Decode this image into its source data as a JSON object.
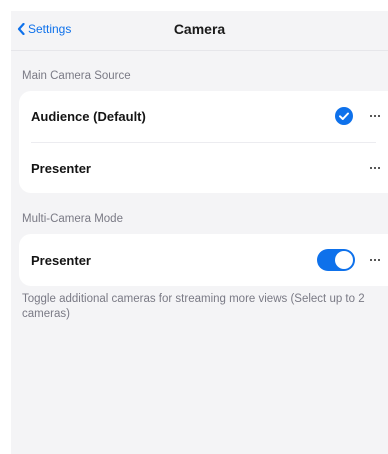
{
  "navbar": {
    "back_label": "Settings",
    "title": "Camera"
  },
  "main_camera": {
    "section_label": "Main Camera Source",
    "rows": [
      {
        "label": "Audience (Default)",
        "selected": true
      },
      {
        "label": "Presenter",
        "selected": false
      }
    ]
  },
  "multi_camera": {
    "section_label": "Multi-Camera Mode",
    "rows": [
      {
        "label": "Presenter",
        "enabled": true
      }
    ],
    "helper_text": "Toggle additional cameras for streaming more views (Select up to 2 cameras)"
  },
  "colors": {
    "accent": "#0e71eb",
    "background": "#f4f4f6",
    "card": "#ffffff",
    "secondary_text": "#7a7a85"
  },
  "icons": {
    "back": "chevron-left-icon",
    "selected": "checkmark-circle-icon",
    "more": "ellipsis-icon"
  }
}
